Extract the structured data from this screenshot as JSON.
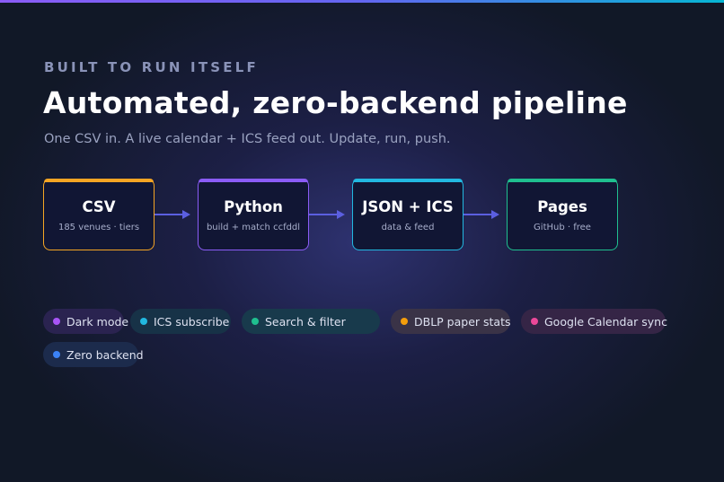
{
  "accent_bar_colors": [
    "#8b5cf6",
    "#6366f1",
    "#06b6d4"
  ],
  "header": {
    "eyebrow": "BUILT TO RUN ITSELF",
    "title": "Automated, zero-backend pipeline",
    "subtitle": "One CSV in. A live calendar + ICS feed out. Update, run, push."
  },
  "pipeline": [
    {
      "title": "CSV",
      "subtitle": "185 venues · tiers",
      "color": "#f5a524"
    },
    {
      "title": "Python",
      "subtitle": "build + match ccfddl",
      "color": "#8b5cf6"
    },
    {
      "title": "JSON + ICS",
      "subtitle": "data & feed",
      "color": "#22b8e0"
    },
    {
      "title": "Pages",
      "subtitle": "GitHub · free",
      "color": "#1fbf8f"
    }
  ],
  "arrow_color": "#5b5fe0",
  "features": [
    {
      "label": "Dark mode",
      "dot_color": "#a855f7",
      "bg_color": "#2a2350"
    },
    {
      "label": "ICS subscribe",
      "dot_color": "#22b8e0",
      "bg_color": "#173247"
    },
    {
      "label": "Search & filter",
      "dot_color": "#1fbf8f",
      "bg_color": "#183a4c"
    },
    {
      "label": "DBLP paper stats",
      "dot_color": "#f59e0b",
      "bg_color": "#3a3347"
    },
    {
      "label": "Google Calendar sync",
      "dot_color": "#ec4899",
      "bg_color": "#352546"
    },
    {
      "label": "Zero backend",
      "dot_color": "#3b82f6",
      "bg_color": "#1c2b4c"
    }
  ]
}
